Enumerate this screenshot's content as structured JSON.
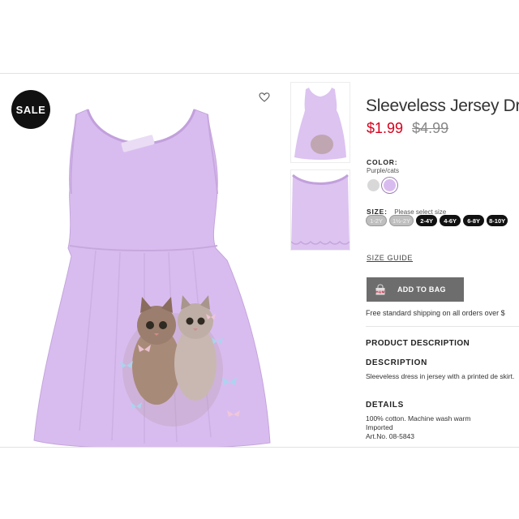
{
  "badge": {
    "sale_label": "SALE"
  },
  "product": {
    "title": "Sleeveless Jersey Dr",
    "price_new": "$1.99",
    "price_old": "$4.99",
    "image_brand_tag": "H&M"
  },
  "color": {
    "label": "COLOR:",
    "value": "Purple/cats",
    "swatches": [
      "#d8d8d8",
      "#d9bcef"
    ]
  },
  "size": {
    "label": "SIZE:",
    "hint": "Please select size",
    "options": [
      {
        "label": "1-2Y",
        "available": false
      },
      {
        "label": "1½-2Y",
        "available": false
      },
      {
        "label": "2-4Y",
        "available": true
      },
      {
        "label": "4-6Y",
        "available": true
      },
      {
        "label": "6-8Y",
        "available": true
      },
      {
        "label": "8-10Y",
        "available": true
      }
    ],
    "guide_label": "SIZE GUIDE"
  },
  "cart": {
    "icon_text": "H&M",
    "add_label": "ADD TO BAG",
    "shipping_note": "Free standard shipping on all orders over $"
  },
  "description": {
    "section_title": "PRODUCT DESCRIPTION",
    "desc_heading": "DESCRIPTION",
    "desc_text": "Sleeveless dress in jersey with a printed de skirt.",
    "details_heading": "DETAILS",
    "details_lines": [
      "100% cotton. Machine wash warm",
      "Imported",
      "Art.No. 08-5843"
    ]
  },
  "colors": {
    "accent_price": "#d6001c",
    "dress_purple": "#d9bcef",
    "button_gray": "#6d6d6d"
  }
}
